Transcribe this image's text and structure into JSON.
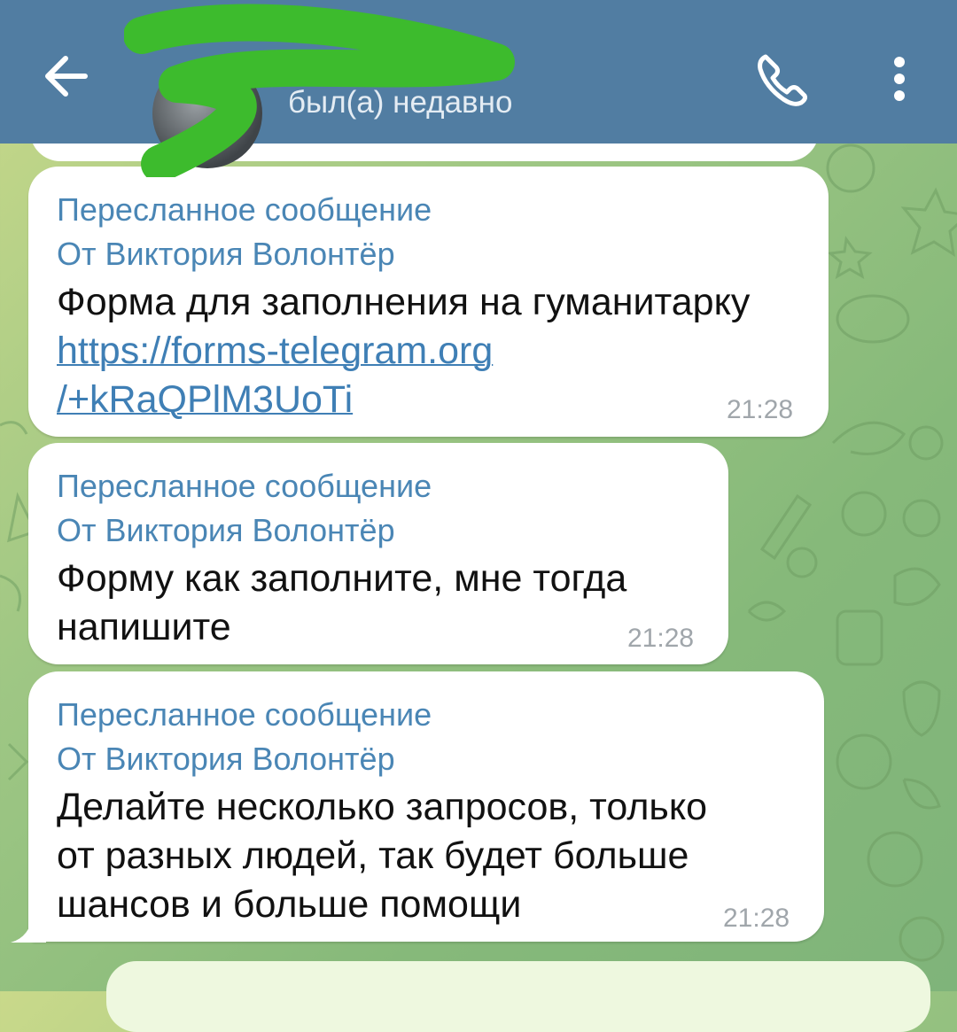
{
  "header": {
    "status": "был(а) недавно"
  },
  "icons": {
    "back": "arrow-left-icon",
    "call": "phone-icon",
    "menu": "more-vertical-icon"
  },
  "colors": {
    "header": "#517da2",
    "forward_text": "#4a86b5",
    "link": "#3f7fb5",
    "bubble": "#ffffff"
  },
  "messages": [
    {
      "forward_label": "Пересланное сообщение",
      "from": "От Виктория Волонтёр",
      "text_before_link": "Форма для заполнения на гуманитарку",
      "link_line1": "https://forms-telegram.org",
      "link_line2": "/+kRaQPlM3UoTi",
      "time": "21:28"
    },
    {
      "forward_label": "Пересланное сообщение",
      "from": "От Виктория Волонтёр",
      "line1": "Форму как заполните, мне тогда",
      "line2": "напишите",
      "time": "21:28"
    },
    {
      "forward_label": "Пересланное сообщение",
      "from": "От Виктория Волонтёр",
      "line1": "Делайте несколько запросов, только",
      "line2": "от разных людей, так будет больше",
      "line3": "шансов и больше помощи",
      "time": "21:28"
    }
  ]
}
